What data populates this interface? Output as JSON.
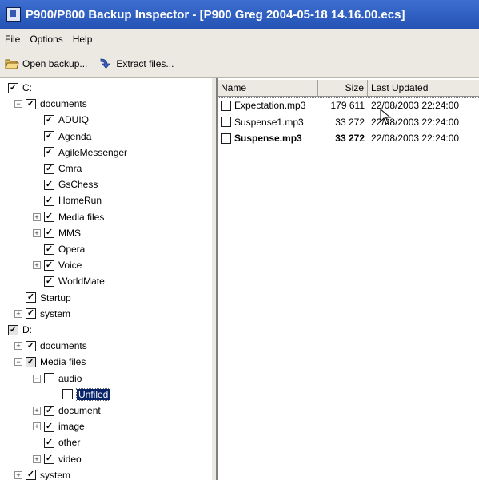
{
  "window": {
    "title": "P900/P800 Backup Inspector - [P900 Greg 2004-05-18 14.16.00.ecs]",
    "app_icon": "app-icon"
  },
  "menu": {
    "items": [
      "File",
      "Options",
      "Help"
    ]
  },
  "toolbar": {
    "open_label": "Open backup...",
    "extract_label": "Extract files...",
    "open_icon": "folder-open-icon",
    "extract_icon": "arrow-icon"
  },
  "tree": {
    "nodes": [
      {
        "label": "C:",
        "check": "checked",
        "expander": "none"
      },
      {
        "label": "documents",
        "check": "checked",
        "expander": "minus"
      },
      {
        "label": "ADUIQ",
        "check": "checked",
        "expander": "none"
      },
      {
        "label": "Agenda",
        "check": "checked",
        "expander": "none"
      },
      {
        "label": "AgileMessenger",
        "check": "checked",
        "expander": "none"
      },
      {
        "label": "Cmra",
        "check": "checked",
        "expander": "none"
      },
      {
        "label": "GsChess",
        "check": "checked",
        "expander": "none"
      },
      {
        "label": "HomeRun",
        "check": "checked",
        "expander": "none"
      },
      {
        "label": "Media files",
        "check": "checked",
        "expander": "plus"
      },
      {
        "label": "MMS",
        "check": "checked",
        "expander": "plus"
      },
      {
        "label": "Opera",
        "check": "checked",
        "expander": "none"
      },
      {
        "label": "Voice",
        "check": "checked",
        "expander": "plus"
      },
      {
        "label": "WorldMate",
        "check": "checked",
        "expander": "none"
      },
      {
        "label": "Startup",
        "check": "checked",
        "expander": "none"
      },
      {
        "label": "system",
        "check": "checked",
        "expander": "plus"
      },
      {
        "label": "D:",
        "check": "partial",
        "expander": "none"
      },
      {
        "label": "documents",
        "check": "checked",
        "expander": "plus"
      },
      {
        "label": "Media files",
        "check": "partial",
        "expander": "minus"
      },
      {
        "label": "audio",
        "check": "unchecked",
        "expander": "minus"
      },
      {
        "label": "Unfiled",
        "check": "unchecked",
        "expander": "none",
        "selected": true
      },
      {
        "label": "document",
        "check": "checked",
        "expander": "plus"
      },
      {
        "label": "image",
        "check": "checked",
        "expander": "plus"
      },
      {
        "label": "other",
        "check": "checked",
        "expander": "none"
      },
      {
        "label": "video",
        "check": "checked",
        "expander": "plus"
      },
      {
        "label": "system",
        "check": "checked",
        "expander": "plus"
      }
    ]
  },
  "list": {
    "columns": [
      "Name",
      "Size",
      "Last Updated"
    ],
    "rows": [
      {
        "name": "Expectation.mp3",
        "size": "179 611",
        "date": "22/08/2003 22:24:00",
        "bold": false,
        "selected": true
      },
      {
        "name": "Suspense1.mp3",
        "size": "33 272",
        "date": "22/08/2003 22:24:00",
        "bold": false,
        "selected": false
      },
      {
        "name": "Suspense.mp3",
        "size": "33 272",
        "date": "22/08/2003 22:24:00",
        "bold": true,
        "selected": false
      }
    ]
  },
  "colors": {
    "titlebar": "#2f62c8",
    "chrome": "#ebe9e2",
    "selection": "#0a246a"
  }
}
